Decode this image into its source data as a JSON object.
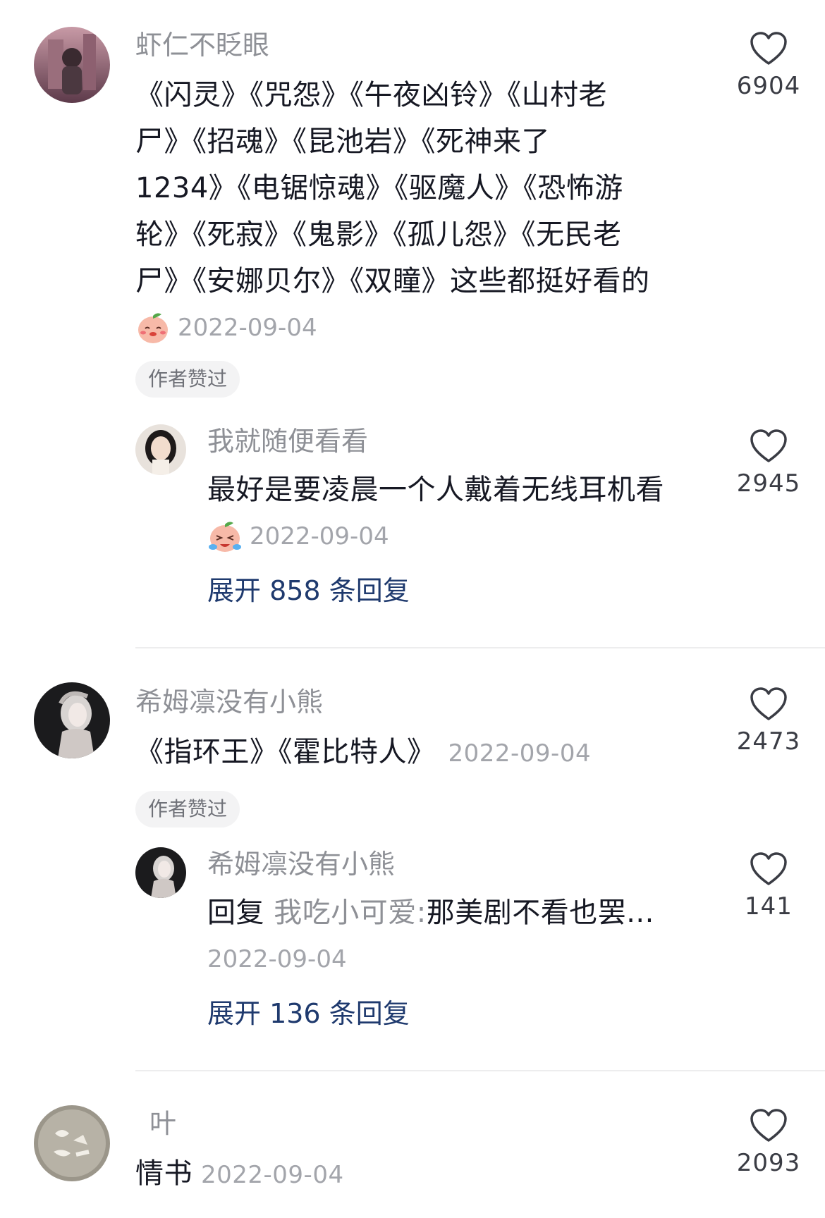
{
  "colors": {
    "username": "#8e9096",
    "text": "#161823",
    "date": "#a3a5ab",
    "expand": "#1f3a6e",
    "badge_bg": "#f3f3f4"
  },
  "comments": [
    {
      "username": "虾仁不眨眼",
      "text_lines": [
        "《闪灵》《咒怨》《午夜凶铃》《山村老",
        "尸》《招魂》《昆池岩》《死神来了",
        "1234》《电锯惊魂》《驱魔人》《恐怖游",
        "轮》《死寂》《鬼影》《孤儿怨》《无民老",
        "尸》《安娜贝尔》《双瞳》这些都挺好看的"
      ],
      "emoji": "blushing-peach-emoji",
      "date": "2022-09-04",
      "badge": "作者赞过",
      "likes": "6904",
      "reply": {
        "username": "我就随便看看",
        "text": "最好是要凌晨一个人戴着无线耳机看",
        "emoji": "crying-peach-emoji",
        "date": "2022-09-04",
        "likes": "2945",
        "expand": "展开 858 条回复"
      }
    },
    {
      "username": "希姆凛没有小熊",
      "text": "《指环王》《霍比特人》",
      "date": "2022-09-04",
      "badge": "作者赞过",
      "likes": "2473",
      "reply": {
        "username": "希姆凛没有小熊",
        "reply_prefix": "回复",
        "reply_to": "我吃小可爱:",
        "text": "那美剧不看也罢...",
        "date": "2022-09-04",
        "likes": "141",
        "expand": "展开 136 条回复"
      }
    },
    {
      "username": "叶",
      "text": "情书",
      "date": "2022-09-04",
      "likes": "2093"
    }
  ]
}
